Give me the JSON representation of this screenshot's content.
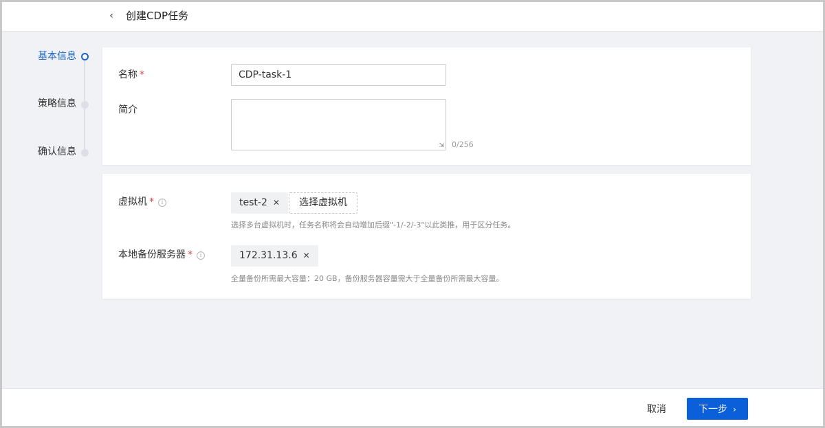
{
  "header": {
    "title": "创建CDP任务"
  },
  "steps": [
    {
      "label": "基本信息",
      "active": true
    },
    {
      "label": "策略信息",
      "active": false
    },
    {
      "label": "确认信息",
      "active": false
    }
  ],
  "basic": {
    "name_label": "名称",
    "name_value": "CDP-task-1",
    "desc_label": "简介",
    "desc_counter": "0/256"
  },
  "resources": {
    "vm_label": "虚拟机",
    "vm_tag": "test-2",
    "vm_select_label": "选择虚拟机",
    "vm_hint": "选择多台虚拟机时，任务名称将会自动增加后缀\"-1/-2/-3\"以此类推，用于区分任务。",
    "server_label": "本地备份服务器",
    "server_tag": "172.31.13.6",
    "server_hint": "全量备份所需最大容量：20 GB，备份服务器容量需大于全量备份所需最大容量。"
  },
  "required_mark": "*",
  "footer": {
    "cancel_label": "取消",
    "next_label": "下一步"
  },
  "colors": {
    "primary": "#0b5fd9",
    "active_step": "#1a63c8",
    "required": "#e23c3c"
  }
}
